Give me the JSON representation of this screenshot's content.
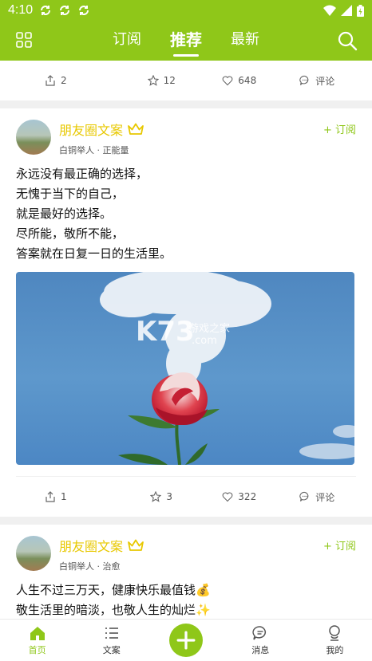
{
  "status": {
    "time": "4:10"
  },
  "nav": {
    "tabs": [
      "订阅",
      "推荐",
      "最新"
    ]
  },
  "first_actions": {
    "share": "2",
    "like": "12",
    "favorite": "648",
    "comment": "评论"
  },
  "posts": [
    {
      "author": "朋友圈文案",
      "subtitle": "白铜举人 · 正能量",
      "follow": "+ 订阅",
      "lines": [
        "永远没有最正确的选择，",
        "无愧于当下的自己，",
        "就是最好的选择。",
        "尽所能，敬所不能，",
        "答案就在日复一日的生活里。"
      ],
      "watermark": "K73",
      "watermark_sub": "游戏之家",
      "watermark_com": ".com",
      "actions": {
        "share": "1",
        "like": "3",
        "favorite": "322",
        "comment": "评论"
      }
    },
    {
      "author": "朋友圈文案",
      "subtitle": "白铜举人 · 治愈",
      "follow": "+ 订阅",
      "lines": [
        "人生不过三万天，健康快乐最值钱💰",
        "敬生活里的暗淡，也敬人生的灿烂✨"
      ]
    }
  ],
  "bottom_nav": {
    "home": "首页",
    "copy": "文案",
    "messages": "消息",
    "mine": "我的"
  },
  "colors": {
    "brand": "#8fc719",
    "author": "#e8c800"
  }
}
